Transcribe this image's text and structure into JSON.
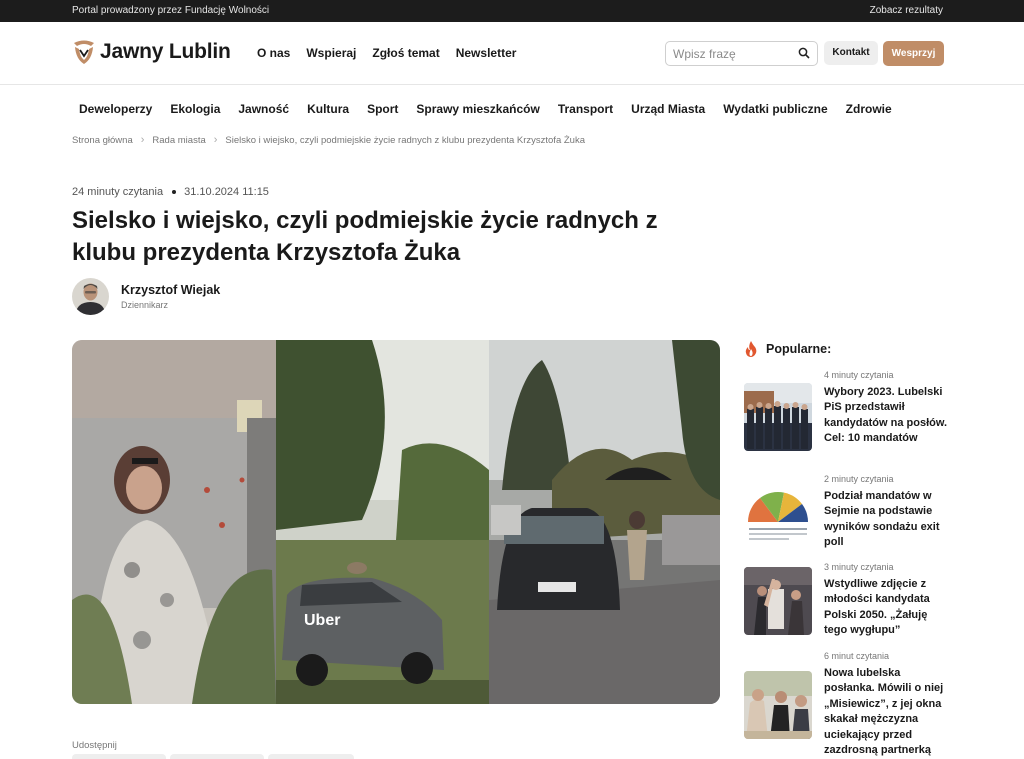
{
  "topbar": {
    "left_text": "Portal prowadzony przez Fundację Wolności",
    "right_link": "Zobacz rezultaty"
  },
  "header": {
    "logo_text": "Jawny Lublin",
    "nav": [
      "O nas",
      "Wspieraj",
      "Zgłoś temat",
      "Newsletter"
    ],
    "search_placeholder": "Wpisz frazę",
    "contact_label": "Kontakt",
    "support_label": "Wesprzyj",
    "accent_color": "#c08d67"
  },
  "categories": [
    "Deweloperzy",
    "Ekologia",
    "Jawność",
    "Kultura",
    "Sport",
    "Sprawy mieszkańców",
    "Transport",
    "Urząd Miasta",
    "Wydatki publiczne",
    "Zdrowie"
  ],
  "breadcrumb": [
    "Strona główna",
    "Rada miasta",
    "Sielsko i wiejsko, czyli podmiejskie życie radnych z klubu prezydenta Krzysztofa Żuka"
  ],
  "article": {
    "reading_time": "24 minuty czytania",
    "date": "31.10.2024 11:15",
    "title": "Sielsko i wiejsko, czyli podmiejskie życie radnych z klubu prezydenta Krzysztofa Żuka",
    "author_name": "Krzysztof Wiejak",
    "author_role": "Dziennikarz",
    "share_label": "Udostępnij"
  },
  "popular": {
    "heading": "Popularne:",
    "items": [
      {
        "read": "4 minuty czytania",
        "title": "Wybory 2023. Lubelski PiS przedstawił kandydatów na posłów. Cel: 10 mandatów"
      },
      {
        "read": "2 minuty czytania",
        "title": "Podział mandatów w Sejmie na podstawie wyników sondażu exit poll"
      },
      {
        "read": "3 minuty czytania",
        "title": "Wstydliwe zdjęcie z młodości kandydata Polski 2050. „Żałuję tego wygłupu”"
      },
      {
        "read": "6 minut czytania",
        "title": "Nowa lubelska posłanka. Mówili o niej „Misiewicz”, z jej okna skakał mężczyzna uciekający przed zazdrosną partnerką"
      }
    ]
  }
}
